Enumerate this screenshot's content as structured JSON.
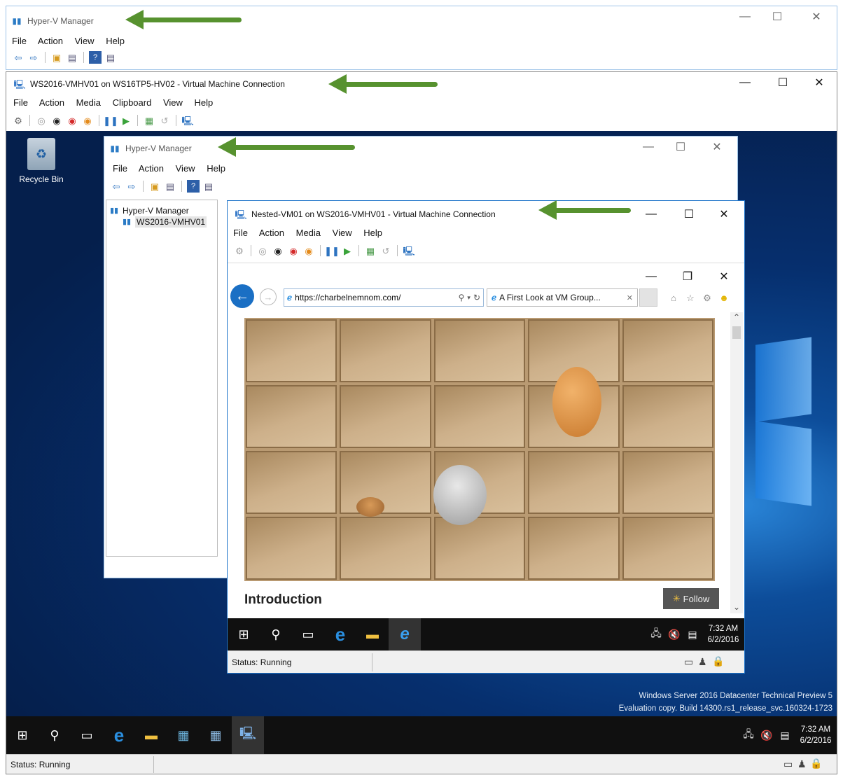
{
  "outer_manager": {
    "title": "Hyper-V Manager",
    "menu": [
      "File",
      "Action",
      "View",
      "Help"
    ],
    "controls": [
      "—",
      "☐",
      "✕"
    ]
  },
  "outer_vmc": {
    "title": "WS2016-VMHV01 on WS16TP5-HV02 - Virtual Machine Connection",
    "menu": [
      "File",
      "Action",
      "Media",
      "Clipboard",
      "View",
      "Help"
    ],
    "controls": [
      "—",
      "☐",
      "✕"
    ]
  },
  "desktop": {
    "recycle_bin_label": "Recycle Bin",
    "watermark_line1": "Windows Server 2016 Datacenter Technical Preview 5",
    "watermark_line2": "Evaluation copy. Build 14300.rs1_release_svc.160324-1723"
  },
  "inner_manager": {
    "title": "Hyper-V Manager",
    "menu": [
      "File",
      "Action",
      "View",
      "Help"
    ],
    "controls": [
      "—",
      "☐",
      "✕"
    ],
    "tree_root": "Hyper-V Manager",
    "tree_child": "WS2016-VMHV01"
  },
  "inner_vmc": {
    "title": "Nested-VM01 on WS2016-VMHV01 - Virtual Machine Connection",
    "menu": [
      "File",
      "Action",
      "Media",
      "View",
      "Help"
    ],
    "controls": [
      "—",
      "☐",
      "✕"
    ],
    "status": "Status: Running"
  },
  "browser": {
    "controls": [
      "—",
      "❐",
      "✕"
    ],
    "url": "https://charbelnemnom.com/",
    "tab_label": "A First Look at VM Group...",
    "heading": "Introduction",
    "follow_label": "Follow"
  },
  "inner_taskbar": {
    "time": "7:32 AM",
    "date": "6/2/2016"
  },
  "outer_taskbar": {
    "time": "7:32 AM",
    "date": "6/2/2016"
  },
  "outer_status": "Status: Running",
  "colors": {
    "arrow": "#57922f",
    "desktop": "#062f6e",
    "edge_blue": "#1e74c9"
  }
}
